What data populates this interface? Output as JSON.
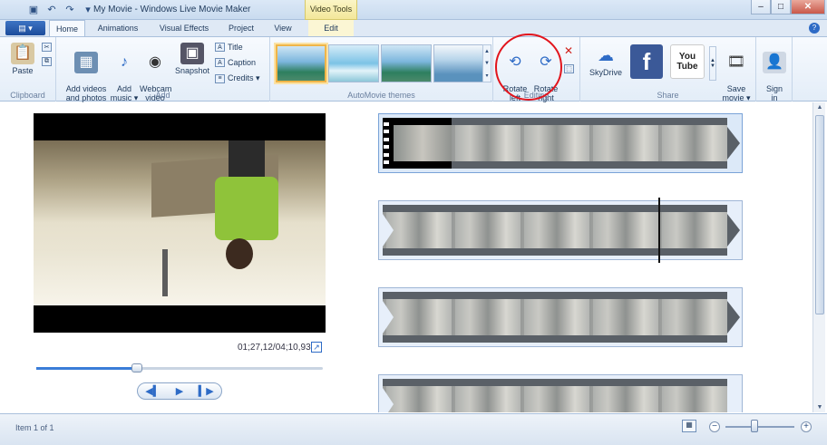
{
  "window": {
    "title": "My Movie - Windows Live Movie Maker",
    "contextual_tab_group": "Video Tools"
  },
  "tabs": [
    {
      "label": "Home",
      "active": true
    },
    {
      "label": "Animations"
    },
    {
      "label": "Visual Effects"
    },
    {
      "label": "Project"
    },
    {
      "label": "View"
    },
    {
      "label": "Edit"
    }
  ],
  "ribbon": {
    "clipboard": {
      "label": "Clipboard",
      "paste": "Paste"
    },
    "add": {
      "label": "Add",
      "add_videos": "Add videos\nand photos",
      "add_music": "Add\nmusic ▾",
      "webcam": "Webcam\nvideo",
      "snapshot": "Snapshot",
      "title": "Title",
      "caption": "Caption",
      "credits": "Credits ▾"
    },
    "themes": {
      "label": "AutoMovie themes"
    },
    "editing": {
      "label": "Editing",
      "rotate_left": "Rotate\nleft",
      "rotate_right": "Rotate\nright"
    },
    "share": {
      "label": "Share",
      "skydrive": "SkyDrive",
      "facebook": "f",
      "youtube": "You\nTube",
      "save_movie": "Save\nmovie ▾"
    },
    "signin": {
      "label": "Sign\nin"
    }
  },
  "preview": {
    "time": "01;27,12/04;10,93",
    "progress": 0.35
  },
  "status": {
    "item": "Item 1 of 1"
  },
  "zoom": {
    "minus": "−",
    "plus": "+"
  },
  "colors": {
    "accent": "#2e6bc6",
    "highlight_circle": "#e2141c"
  }
}
